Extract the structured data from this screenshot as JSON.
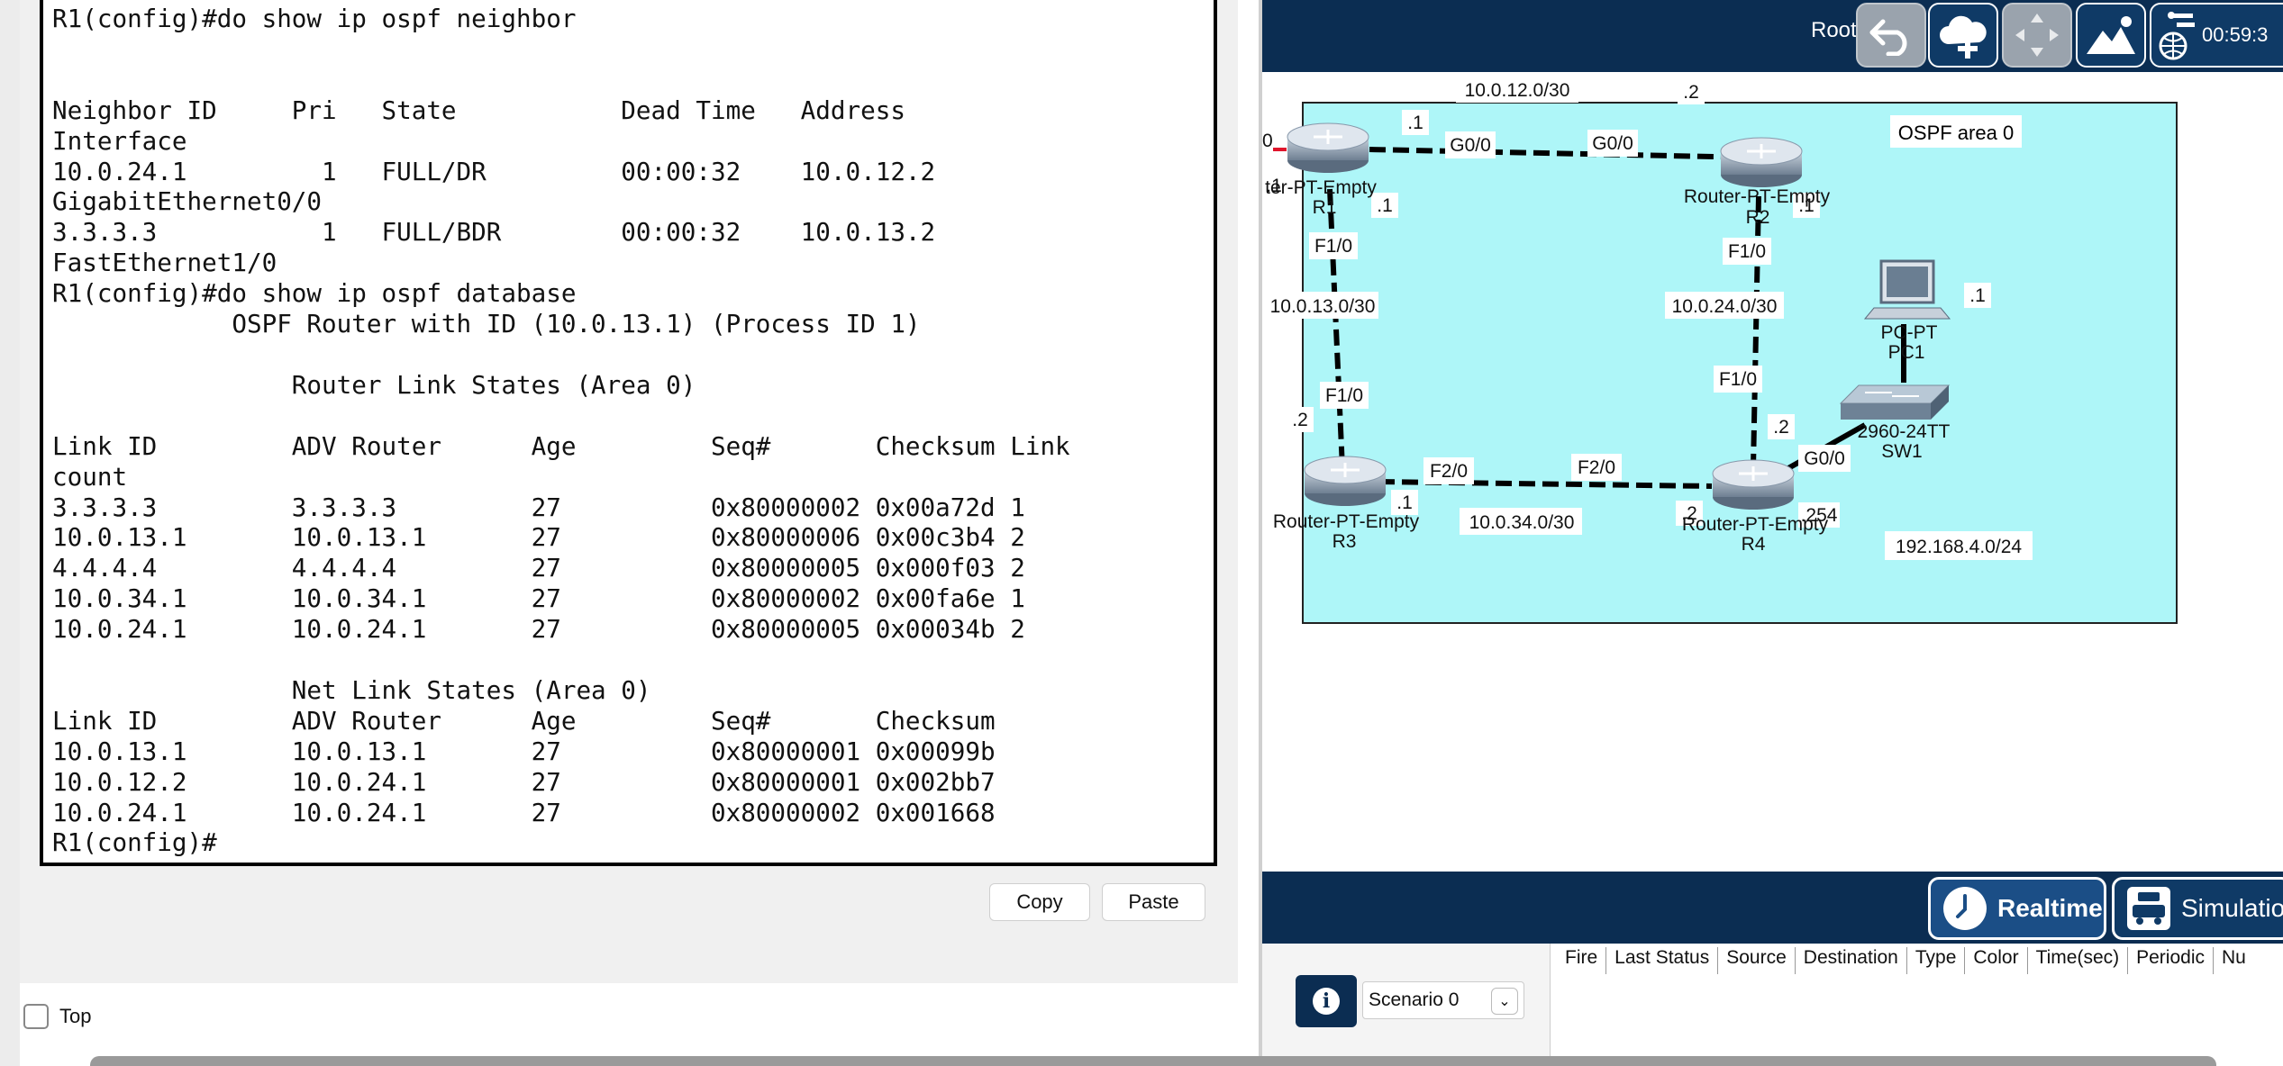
{
  "terminal": {
    "lines": [
      "R1(config)#do show ip ospf neighbor",
      "",
      "",
      "Neighbor ID     Pri   State           Dead Time   Address",
      "Interface",
      "10.0.24.1         1   FULL/DR         00:00:32    10.0.12.2",
      "GigabitEthernet0/0",
      "3.3.3.3           1   FULL/BDR        00:00:32    10.0.13.2",
      "FastEthernet1/0",
      "R1(config)#do show ip ospf database",
      "            OSPF Router with ID (10.0.13.1) (Process ID 1)",
      "",
      "                Router Link States (Area 0)",
      "",
      "Link ID         ADV Router      Age         Seq#       Checksum Link",
      "count",
      "3.3.3.3         3.3.3.3         27          0x80000002 0x00a72d 1",
      "10.0.13.1       10.0.13.1       27          0x80000006 0x00c3b4 2",
      "4.4.4.4         4.4.4.4         27          0x80000005 0x000f03 2",
      "10.0.34.1       10.0.34.1       27          0x80000002 0x00fa6e 1",
      "10.0.24.1       10.0.24.1       27          0x80000005 0x00034b 2",
      "",
      "                Net Link States (Area 0)",
      "Link ID         ADV Router      Age         Seq#       Checksum",
      "10.0.13.1       10.0.13.1       27          0x80000001 0x00099b",
      "10.0.12.2       10.0.24.1       27          0x80000001 0x002bb7",
      "10.0.24.1       10.0.24.1       27          0x80000002 0x001668",
      "R1(config)#"
    ]
  },
  "cli_buttons": {
    "copy": "Copy",
    "paste": "Paste"
  },
  "top_checkbox": {
    "label": "Top",
    "checked": false
  },
  "toolbar": {
    "root_label": "Root",
    "clock": "00:59:3",
    "icons": [
      "undo-icon",
      "cloud-add-icon",
      "move-icon",
      "image-icon",
      "clock-network-icon"
    ]
  },
  "topology": {
    "area_label": "OSPF area 0",
    "area_color": "#aef6f8",
    "devices": [
      {
        "id": "R1",
        "model": "ter-PT-Empty",
        "name": "R1"
      },
      {
        "id": "R2",
        "model": "Router-PT-Empty",
        "name": "R2"
      },
      {
        "id": "R3",
        "model": "Router-PT-Empty",
        "name": "R3"
      },
      {
        "id": "R4",
        "model": "Router-PT-Empty",
        "name": "R4"
      },
      {
        "id": "SW1",
        "model": "2960-24TT",
        "name": "SW1"
      },
      {
        "id": "PC1",
        "model": "PC-PT",
        "name": "PC1"
      }
    ],
    "networks": [
      "10.0.12.0/30",
      "10.0.13.0/30",
      "10.0.24.0/30",
      "10.0.34.0/30",
      "192.168.4.0/24"
    ],
    "interfaces": {
      "r1_g": "G0/0",
      "r2_g": "G0/0",
      "r1_f": "F1/0",
      "r3_f1": "F1/0",
      "r2_f": "F1/0",
      "r4_f1": "F1/0",
      "r3_f2": "F2/0",
      "r4_f2": "F2/0",
      "r4_g": "G0/0"
    },
    "host_ids": {
      "r1_top": ".1",
      "r2_top": ".2",
      "r1_left": ".1",
      "r1_f": ".1",
      "r2_f": ".1",
      "r3_top": ".2",
      "r3_f2": ".1",
      "r4_f1": ".2",
      "r4_f2": ".2",
      "r4_g": ".254",
      "pc1": ".1"
    },
    "partial_left_label": "0"
  },
  "mode_buttons": {
    "realtime": "Realtime",
    "simulation": "Simulation"
  },
  "scenario": {
    "selected": "Scenario 0",
    "info_icon": "info-icon"
  },
  "pdu_table": {
    "columns": [
      "Fire",
      "Last Status",
      "Source",
      "Destination",
      "Type",
      "Color",
      "Time(sec)",
      "Periodic",
      "Nu"
    ]
  }
}
